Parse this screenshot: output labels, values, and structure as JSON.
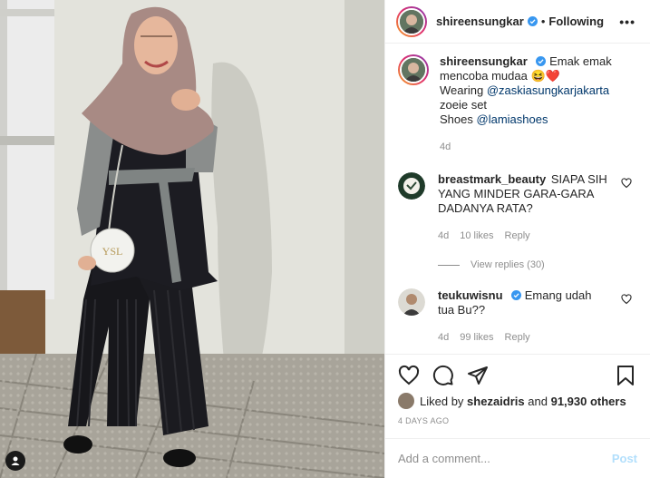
{
  "post": {
    "username": "shireensungkar",
    "follow_status": "Following",
    "more": "•••",
    "caption": {
      "username": "shireensungkar",
      "line1": "Emak emak",
      "line2": "mencoba mudaa",
      "emoji": "😆❤️",
      "wearing_prefix": "Wearing",
      "wearing_link": "@zaskiasungkarjakarta",
      "line4": "zoeie set",
      "shoes_prefix": "Shoes",
      "shoes_link": "@lamiashoes",
      "time": "4d"
    },
    "comments": [
      {
        "username": "breastmark_beauty",
        "text": "SIAPA SIH YANG MINDER GARA-GARA DADANYA RATA?",
        "time": "4d",
        "likes": "10 likes",
        "reply": "Reply",
        "view_replies": "View replies (30)"
      },
      {
        "username": "teukuwisnu",
        "text": "Emang udah tua Bu??",
        "time": "4d",
        "likes": "99 likes",
        "reply": "Reply"
      }
    ],
    "likes": {
      "prefix": "Liked by",
      "user": "shezaidris",
      "and": "and",
      "count": "91,930 others"
    },
    "timestamp": "4 DAYS AGO",
    "comment_placeholder": "Add a comment...",
    "post_button": "Post"
  },
  "colors": {
    "verified": "#3897f0",
    "link": "#00376b",
    "muted": "#8e8e8e",
    "post_disabled": "#b2dffc"
  }
}
